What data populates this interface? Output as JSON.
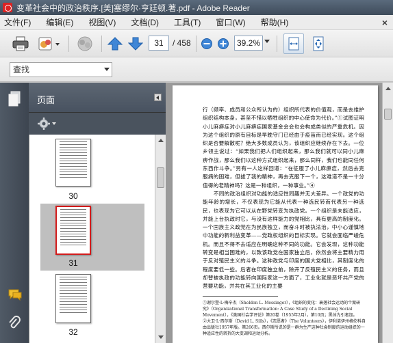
{
  "window": {
    "title": "变革社会中的政治秩序.[美]塞缪尔·亨廷顿.著.pdf - Adobe Reader"
  },
  "menu": {
    "items": [
      "文件(F)",
      "编辑(E)",
      "视图(V)",
      "文档(D)",
      "工具(T)",
      "窗口(W)",
      "帮助(H)"
    ],
    "close_symbol": "×"
  },
  "toolbar": {
    "current_page": "31",
    "page_total": "/ 458",
    "zoom": "39.2%"
  },
  "find": {
    "placeholder": "查找",
    "value": "查找"
  },
  "panel": {
    "title": "页面",
    "thumbnails": [
      {
        "label": "30",
        "selected": false
      },
      {
        "label": "31",
        "selected": true
      },
      {
        "label": "32",
        "selected": false
      }
    ]
  },
  "document": {
    "paragraphs": [
      {
        "indent": false,
        "text": "行（频率、成员和公众所认为的）组织所代表的价值观，而是去维护组织结构本身，甚至不惜以牺牲组织的中心使命为代价。”①试图证明小儿麻痹症对小儿麻痹症国家基金会会也会构成类似的严重危机。因为这个组织的原有目标是早晚守门已经由于疫苗而已经实现。这个组织是否要解散呢？绝大多数成员认为，该组织应继续存在下去。一位乡领主说过：“如果我们把人们组织起来，那么我们就可以同小儿麻痹作战，那么我们以这种方式组织起来，那么同样，我们也能同任何东西作斗争。”另有一人这样回道：“在征服了小儿麻痹症，然后去克服病的困难，但拔了我的精神，再去克服下一个，这难道不是一十分值得的老精神吗？这是一种组织，一种事业。”④"
      },
      {
        "indent": true,
        "text": "不同的政治组织对功能的适应性同趣并无大差异。一个政党的功能年龄的增长，不仅表现为它能从代表一种选民转而代表另一种选民，也表现为它可以从在野党转变为执政党。一个组织是未能适应，并能上台执政时它，与没有这样能力的党相比，具有更高的制度化。一个国族主义政党在为民族独立，而奋斗时被执法治，中小心谨慎地中功能的新利益变革——党政权组织的目标实现。它就会面临严峻危机。而且不得不去适应在明确这种不同的功能。它会发现，这种功能转变是相当困难的，以致该政党在国家独立后，依然会将主要精力用于反对殖民主义的斗争。这种政党与印度的国大党相比，其制度化的程度要低一些。后者在印度独立前，除开了反殖民主义的任务，而且却替被执政的功能转向国际家这一方面了，工业化就是恶坏共产党的营要功能，并共在其工业化的主要"
      }
    ],
    "footnotes": [
      "①谢尔登·L·梅辛杰（Sheldon L. Messinger），《组织的变化：衰落社会运动的个案研究》（Organizational Transformation: A Case Study of a Declining Social Movement），《美国社会学评论》第20卷（1955年2月），第10页；黑体为引者加。",
      "②大卫·L·西尔斯（David L. Sills），《志愿者》（The Volunteers），伊利诺伊州格伦科自由出版社1957年版。第266页。西尔斯所说的是一群为生产这种社会制度的运动组织的一种适应性的转折的大变调和运动分析。"
    ]
  }
}
